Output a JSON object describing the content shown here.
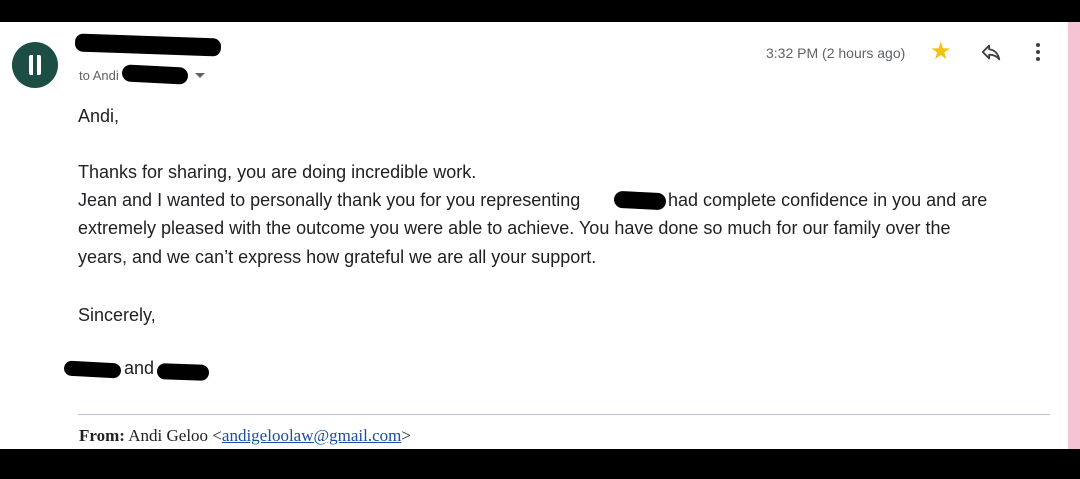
{
  "email": {
    "to_prefix": "to Andi",
    "timestamp": "3:32 PM (2 hours ago)",
    "icons": {
      "star": "star-icon",
      "reply": "reply-icon",
      "more": "more-vert-icon",
      "dropdown": "chevron-down-icon"
    },
    "colors": {
      "avatar": "#1d4e45",
      "star": "#f4c20d",
      "link": "#1a4fa0"
    }
  },
  "body": {
    "greeting": "Andi,",
    "line1": "Thanks for sharing, you are doing incredible work.",
    "line2a": " Jean and I wanted to personally thank you for you representing",
    "line2b": "We had complete confidence in you and are",
    "line3": "extremely pleased with the outcome you were able to achieve. You have done so much for our family over the",
    "line4": "years, and we can’t express how grateful we are all your support.",
    "closing": "Sincerely,",
    "signature_and": "and"
  },
  "forwarded": {
    "from_label": "From:",
    "from_name": "Andi Geloo <",
    "from_email": "andigeloolaw@gmail.com",
    "from_close": ">"
  }
}
